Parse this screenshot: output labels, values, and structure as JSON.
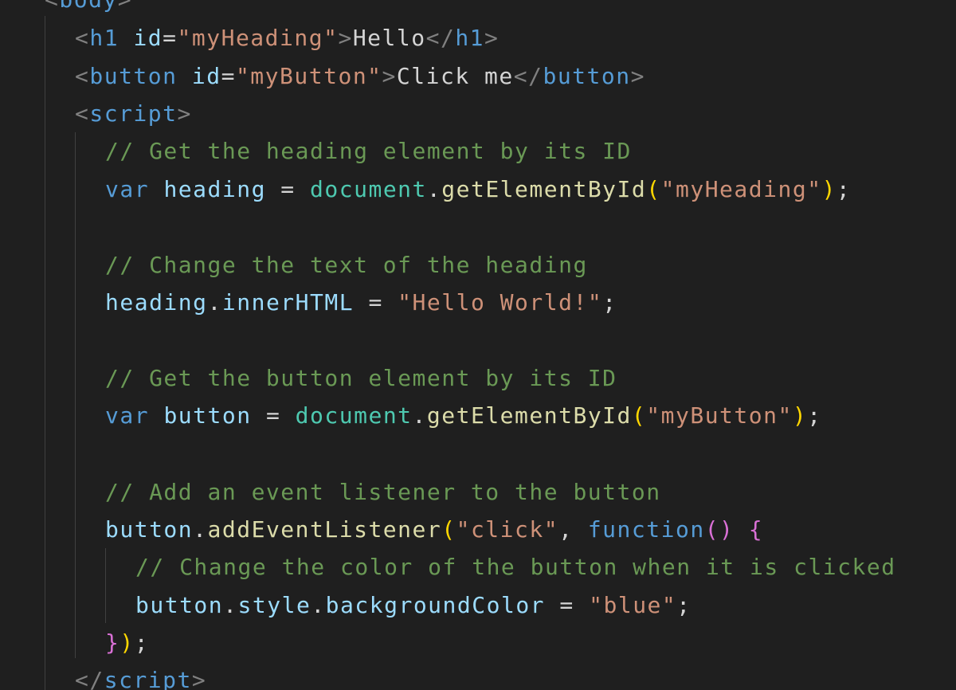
{
  "colors": {
    "background": "#1f1f1f",
    "tag": "#569cd6",
    "punctuation": "#808080",
    "attribute": "#9cdcfe",
    "string": "#ce9178",
    "comment": "#6a9955",
    "function": "#dcdcaa",
    "object": "#4ec9b0",
    "bracket1": "#ffd700",
    "bracket2": "#da70d6"
  },
  "code": {
    "l0": {
      "tag": "body"
    },
    "l1": {
      "tag_open": "h1",
      "attr": "id",
      "attr_val": "\"myHeading\"",
      "text": "Hello",
      "tag_close": "h1"
    },
    "l2": {
      "tag_open": "button",
      "attr": "id",
      "attr_val": "\"myButton\"",
      "text": "Click me",
      "tag_close": "button"
    },
    "l3": {
      "tag": "script"
    },
    "l4": {
      "comment": "// Get the heading element by its ID"
    },
    "l5": {
      "kw": "var",
      "var": "heading",
      "eq": " = ",
      "obj": "document",
      "fn": "getElementById",
      "arg": "\"myHeading\""
    },
    "l7": {
      "comment": "// Change the text of the heading"
    },
    "l8": {
      "obj": "heading",
      "prop": "innerHTML",
      "eq": " = ",
      "val": "\"Hello World!\""
    },
    "l10": {
      "comment": "// Get the button element by its ID"
    },
    "l11": {
      "kw": "var",
      "var": "button",
      "eq": " = ",
      "obj": "document",
      "fn": "getElementById",
      "arg": "\"myButton\""
    },
    "l13": {
      "comment": "// Add an event listener to the button"
    },
    "l14": {
      "obj": "button",
      "fn": "addEventListener",
      "arg": "\"click\"",
      "kw": "function"
    },
    "l15": {
      "comment": "// Change the color of the button when it is clicked"
    },
    "l16": {
      "obj": "button",
      "prop1": "style",
      "prop2": "backgroundColor",
      "eq": " = ",
      "val": "\"blue\""
    },
    "l18": {
      "tag": "script"
    }
  }
}
